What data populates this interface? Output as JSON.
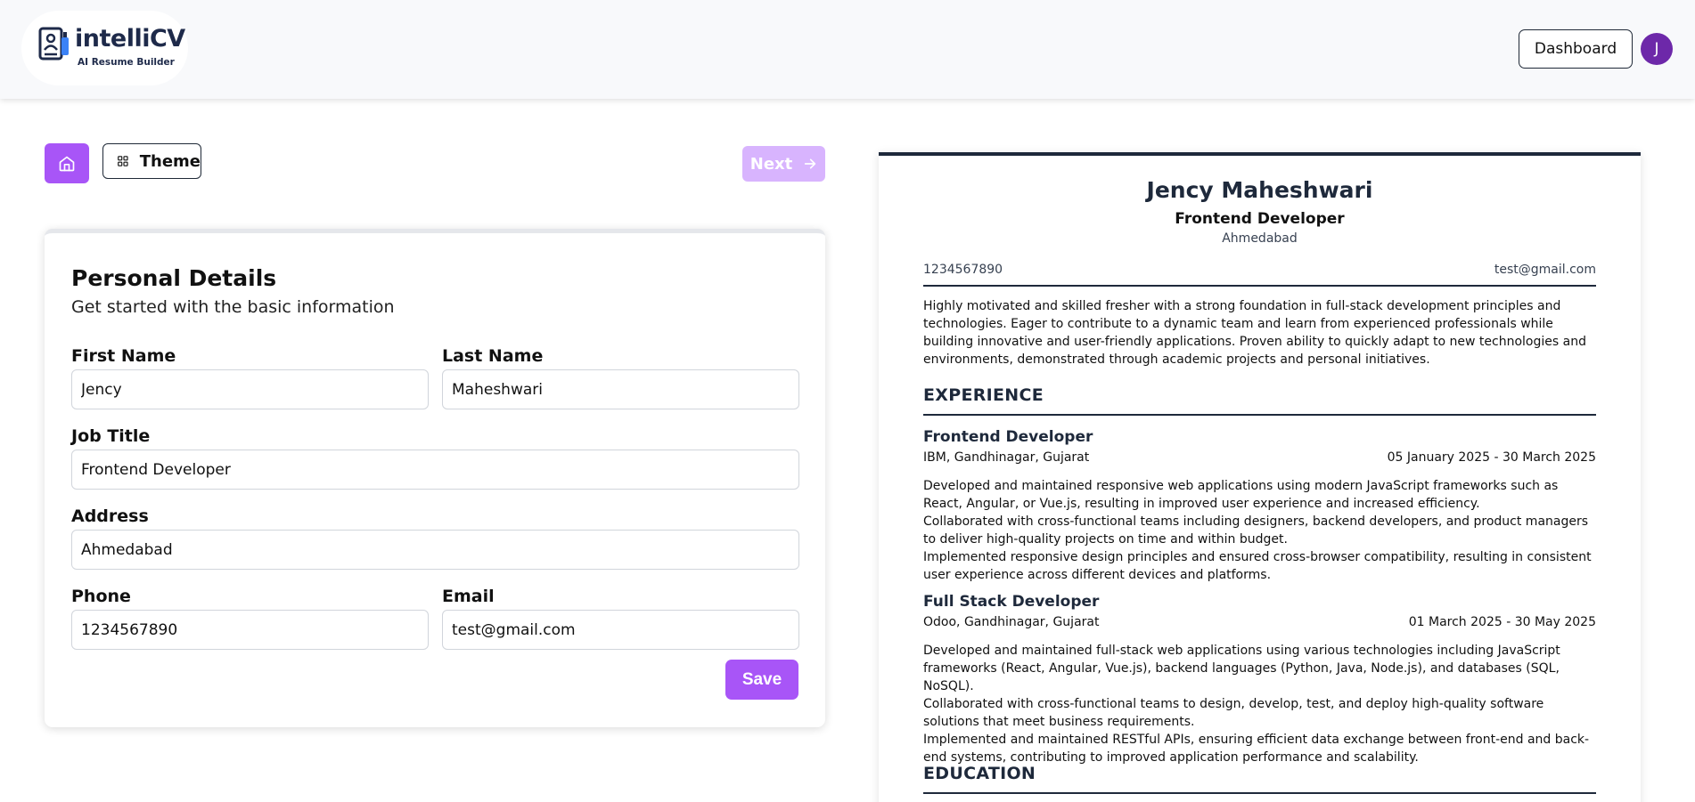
{
  "header": {
    "logo_name": "intelliCV",
    "logo_tagline": "AI Resume Builder",
    "dashboard_label": "Dashboard",
    "avatar_initial": "J",
    "accent_color": "#a855f7",
    "avatar_color": "#6d28a9"
  },
  "toolbar": {
    "home_icon": "home-icon",
    "theme_label": "Theme",
    "theme_icon": "grid-icon",
    "next_label": "Next",
    "next_icon": "arrow-right-icon"
  },
  "form": {
    "title": "Personal Details",
    "subtitle": "Get started with the basic information",
    "first_name_label": "First Name",
    "first_name_value": "Jency",
    "last_name_label": "Last Name",
    "last_name_value": "Maheshwari",
    "job_title_label": "Job Title",
    "job_title_value": "Frontend Developer",
    "address_label": "Address",
    "address_value": "Ahmedabad",
    "phone_label": "Phone",
    "phone_value": "1234567890",
    "email_label": "Email",
    "email_value": "test@gmail.com",
    "save_label": "Save"
  },
  "resume": {
    "name": "Jency Maheshwari",
    "title": "Frontend Developer",
    "address": "Ahmedabad",
    "phone": "1234567890",
    "email": "test@gmail.com",
    "summary": "Highly motivated and skilled fresher with a strong foundation in full-stack development principles and technologies. Eager to contribute to a dynamic team and learn from experienced professionals while building innovative and user-friendly applications. Proven ability to quickly adapt to new technologies and environments, demonstrated through academic projects and personal initiatives.",
    "experience_heading": "EXPERIENCE",
    "experience": [
      {
        "position": "Frontend Developer",
        "company": "IBM, Gandhinagar, Gujarat",
        "dates": "05 January 2025 - 30 March 2025",
        "description": "Developed and maintained responsive web applications using modern JavaScript frameworks such as React, Angular, or Vue.js, resulting in improved user experience and increased efficiency.\nCollaborated with cross-functional teams including designers, backend developers, and product managers to deliver high-quality projects on time and within budget.\nImplemented responsive design principles and ensured cross-browser compatibility, resulting in consistent user experience across different devices and platforms."
      },
      {
        "position": "Full Stack Developer",
        "company": "Odoo, Gandhinagar, Gujarat",
        "dates": "01 March 2025 - 30 May 2025",
        "description": "Developed and maintained full-stack web applications using various technologies including JavaScript frameworks (React, Angular, Vue.js), backend languages (Python, Java, Node.js), and databases (SQL, NoSQL).\nCollaborated with cross-functional teams to design, develop, test, and deploy high-quality software solutions that meet business requirements.\nImplemented and maintained RESTful APIs, ensuring efficient data exchange between front-end and back-end systems, contributing to improved application performance and scalability."
      }
    ],
    "education_heading": "EDUCATION",
    "border_color": "#1e293b"
  }
}
